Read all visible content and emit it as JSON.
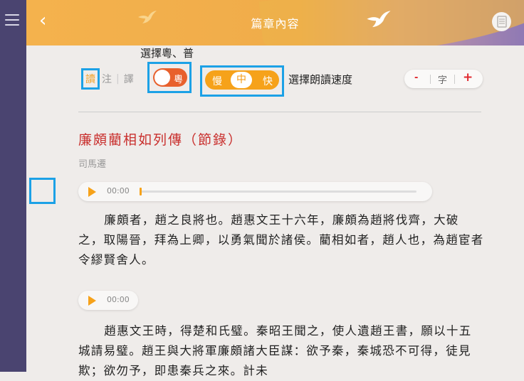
{
  "header": {
    "title": "篇章內容"
  },
  "toolbar": {
    "lang_label": "選擇粵、普",
    "modes": [
      "讀",
      "注",
      "譯"
    ],
    "lang_value": "粵",
    "speed": [
      "慢",
      "中",
      "快"
    ],
    "speed_label": "選擇朗讀速度",
    "font_minus": "-",
    "font_label": "字",
    "font_plus": "+"
  },
  "chapter": {
    "title": "廉頗藺相如列傳（節錄）",
    "author": "司馬遷"
  },
  "player": {
    "time": "00:00",
    "progress": 0
  },
  "paragraphs": [
    "廉頗者，趙之良將也。趙惠文王十六年，廉頗為趙將伐齊，大破之，取陽晉，拜為上卿，以勇氣聞於諸侯。藺相如者，趙人也，為趙宦者令繆賢舍人。",
    "趙惠文王時，得楚和氏璧。秦昭王聞之，使人遺趙王書，願以十五城請易璧。趙王與大將軍廉頗諸大臣謀：欲予秦，秦城恐不可得，徒見欺；欲勿予，即患秦兵之來。計未"
  ],
  "colors": {
    "accent": "#f6a21a",
    "title_red": "#c9302e",
    "highlight": "#1ca1e6"
  }
}
